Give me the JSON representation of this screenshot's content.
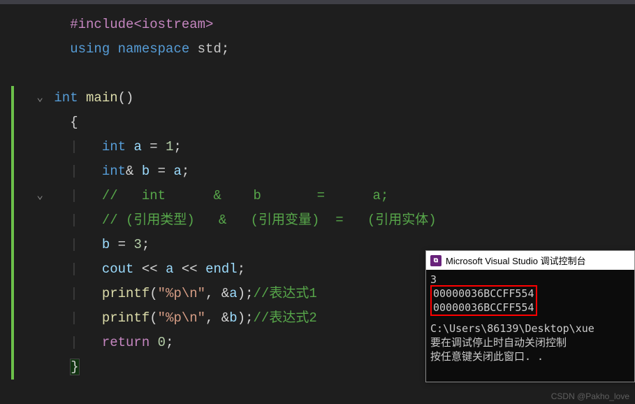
{
  "code": {
    "l1_pre": "#include",
    "l1_inc": "<iostream>",
    "l2_kw": "using namespace",
    "l2_ns": " std",
    "l2_sc": ";",
    "l4_type": "int",
    "l4_fn": " main",
    "l4_par": "()",
    "l5_brace": "{",
    "l6_type": "int",
    "l6_var": " a ",
    "l6_op": "= ",
    "l6_num": "1",
    "l6_sc": ";",
    "l7_type": "int",
    "l7_amp": "&",
    "l7_var": " b ",
    "l7_op": "= ",
    "l7_var2": "a",
    "l7_sc": ";",
    "l8_cmt": "//   int      &    b       =      a;",
    "l9_cmt": "// (引用类型)   &   (引用变量)  =   (引用实体)",
    "l10_var": "b ",
    "l10_op": "= ",
    "l10_num": "3",
    "l10_sc": ";",
    "l11_cout": "cout ",
    "l11_op1": "<< ",
    "l11_var": "a ",
    "l11_op2": "<< ",
    "l11_endl": "endl",
    "l11_sc": ";",
    "l12_fn": "printf",
    "l12_p1": "(",
    "l12_str": "\"%p\\n\"",
    "l12_cm": ", ",
    "l12_amp": "&",
    "l12_var": "a",
    "l12_p2": ")",
    "l12_sc": ";",
    "l12_cmt": "//表达式1",
    "l13_fn": "printf",
    "l13_p1": "(",
    "l13_str": "\"%p\\n\"",
    "l13_cm": ", ",
    "l13_amp": "&",
    "l13_var": "b",
    "l13_p2": ")",
    "l13_sc": ";",
    "l13_cmt": "//表达式2",
    "l14_kw": "return",
    "l14_num": " 0",
    "l14_sc": ";",
    "l15_brace": "}"
  },
  "console": {
    "title": "Microsoft Visual Studio 调试控制台",
    "out1": "3",
    "out2": "00000036BCCFF554",
    "out3": "00000036BCCFF554",
    "path": "C:\\Users\\86139\\Desktop\\xue",
    "msg1": "要在调试停止时自动关闭控制",
    "msg2": "按任意键关闭此窗口. ."
  },
  "watermark": "CSDN @Pakho_love"
}
